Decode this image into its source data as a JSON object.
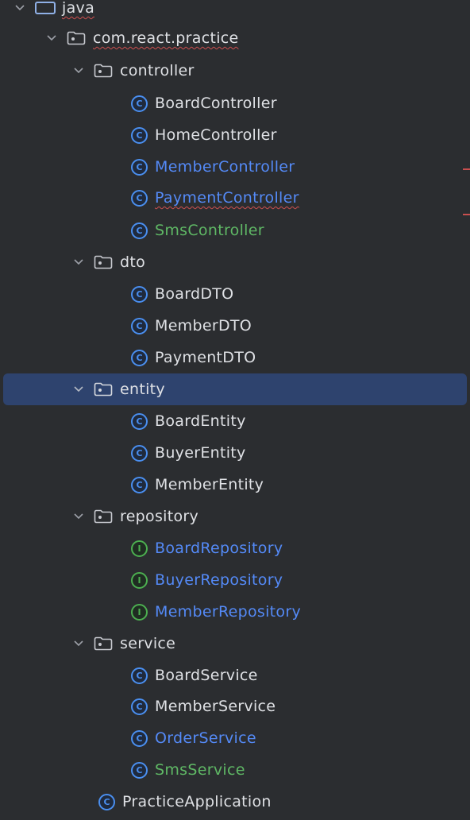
{
  "tree": {
    "root": {
      "label": "java",
      "icon": "source-root-folder-icon",
      "expanded": true
    },
    "package": {
      "label": "com.react.practice",
      "icon": "package-folder-icon",
      "expanded": true
    },
    "groups": [
      {
        "label": "controller",
        "expanded": true,
        "items": [
          {
            "label": "BoardController",
            "kind": "class",
            "color": "default"
          },
          {
            "label": "HomeController",
            "kind": "class",
            "color": "default"
          },
          {
            "label": "MemberController",
            "kind": "class",
            "color": "blue"
          },
          {
            "label": "PaymentController",
            "kind": "class",
            "color": "blue"
          },
          {
            "label": "SmsController",
            "kind": "class",
            "color": "green"
          }
        ]
      },
      {
        "label": "dto",
        "expanded": true,
        "items": [
          {
            "label": "BoardDTO",
            "kind": "class",
            "color": "default"
          },
          {
            "label": "MemberDTO",
            "kind": "class",
            "color": "default"
          },
          {
            "label": "PaymentDTO",
            "kind": "class",
            "color": "default"
          }
        ]
      },
      {
        "label": "entity",
        "expanded": true,
        "selected": true,
        "items": [
          {
            "label": "BoardEntity",
            "kind": "class",
            "color": "default"
          },
          {
            "label": "BuyerEntity",
            "kind": "class",
            "color": "default"
          },
          {
            "label": "MemberEntity",
            "kind": "class",
            "color": "default"
          }
        ]
      },
      {
        "label": "repository",
        "expanded": true,
        "items": [
          {
            "label": "BoardRepository",
            "kind": "interface",
            "color": "blue"
          },
          {
            "label": "BuyerRepository",
            "kind": "interface",
            "color": "blue"
          },
          {
            "label": "MemberRepository",
            "kind": "interface",
            "color": "blue"
          }
        ]
      },
      {
        "label": "service",
        "expanded": true,
        "items": [
          {
            "label": "BoardService",
            "kind": "class",
            "color": "default"
          },
          {
            "label": "MemberService",
            "kind": "class",
            "color": "default"
          },
          {
            "label": "OrderService",
            "kind": "class",
            "color": "blue"
          },
          {
            "label": "SmsService",
            "kind": "class",
            "color": "green"
          }
        ]
      }
    ],
    "app": {
      "label": "PracticeApplication",
      "kind": "class",
      "color": "default"
    },
    "icon_glyphs": {
      "class": "C",
      "interface": "I"
    },
    "colors": {
      "background": "#2b2d30",
      "selection": "#2e436e",
      "default_text": "#dfe1e5",
      "modified_blue": "#548af7",
      "added_green": "#5fb865",
      "error_underline": "#d05050"
    }
  }
}
